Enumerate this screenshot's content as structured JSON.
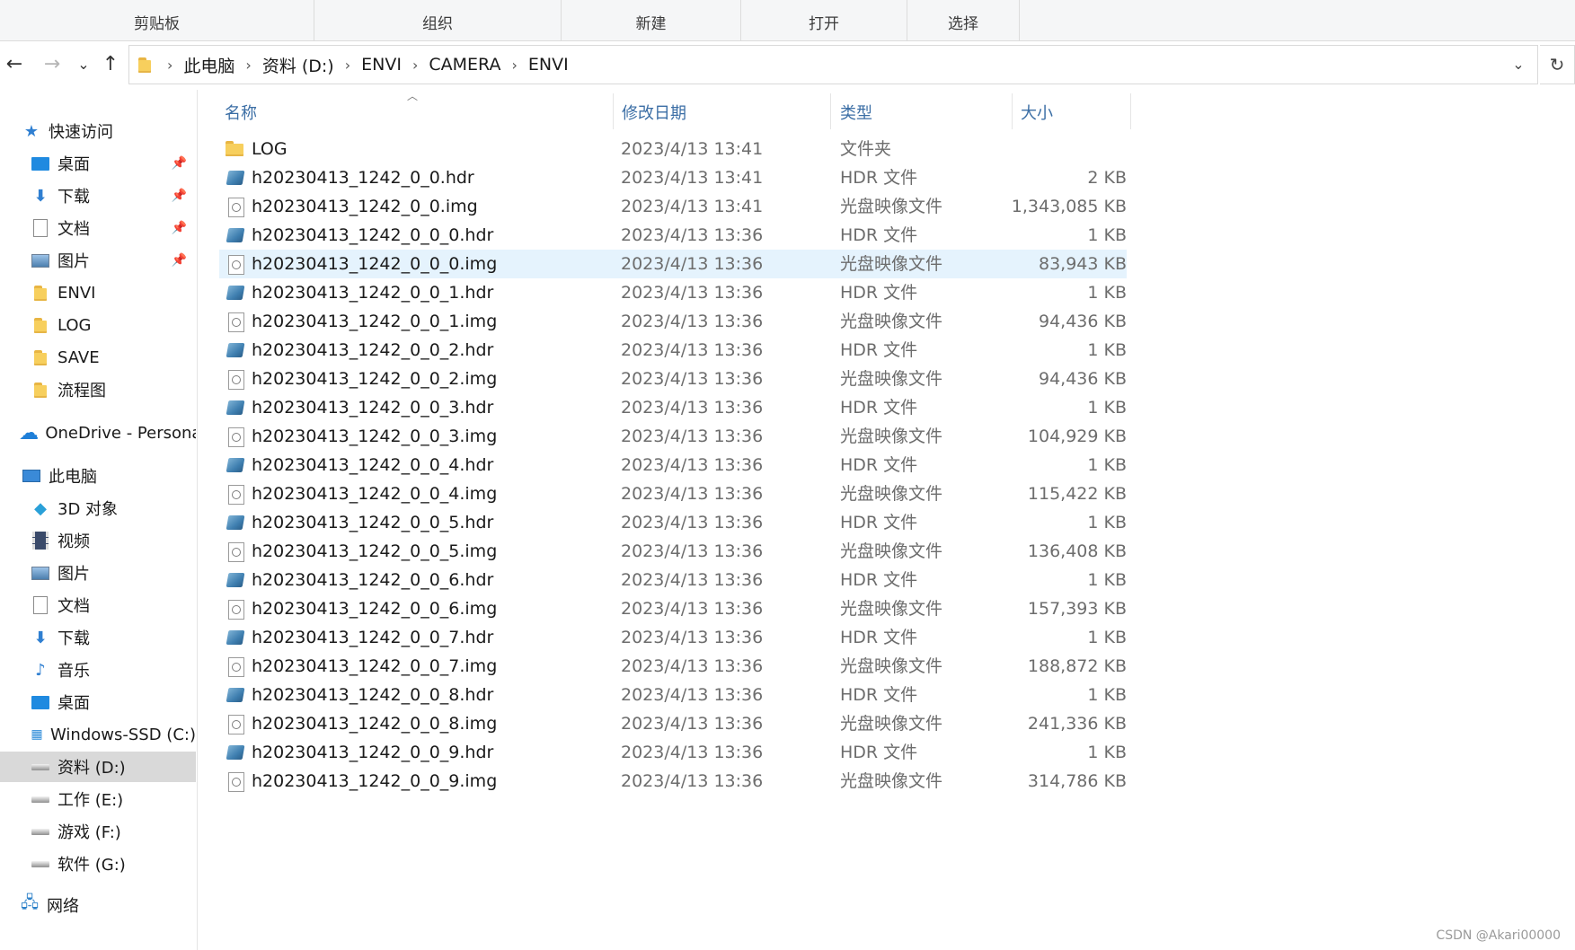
{
  "ribbon": {
    "groups": [
      "剪贴板",
      "组织",
      "新建",
      "打开",
      "选择"
    ]
  },
  "nav": {
    "back_icon": "←",
    "forward_icon": "→",
    "recent_icon": "⌄",
    "up_icon": "↑",
    "breadcrumb": [
      "此电脑",
      "资料 (D:)",
      "ENVI",
      "CAMERA",
      "ENVI"
    ],
    "separator": "›",
    "dropdown_icon": "⌄",
    "refresh_icon": "↻"
  },
  "sidebar": {
    "quick_access": "快速访问",
    "quick_items": [
      {
        "label": "桌面",
        "icon": "desktop-icon",
        "pinned": true
      },
      {
        "label": "下载",
        "icon": "download-icon",
        "pinned": true
      },
      {
        "label": "文档",
        "icon": "document-icon",
        "pinned": true
      },
      {
        "label": "图片",
        "icon": "picture-icon",
        "pinned": true
      },
      {
        "label": "ENVI",
        "icon": "folder-icon",
        "pinned": false
      },
      {
        "label": "LOG",
        "icon": "folder-icon",
        "pinned": false
      },
      {
        "label": "SAVE",
        "icon": "folder-icon",
        "pinned": false
      },
      {
        "label": "流程图",
        "icon": "folder-icon",
        "pinned": false
      }
    ],
    "onedrive": "OneDrive - Personal",
    "this_pc": "此电脑",
    "pc_items": [
      {
        "label": "3D 对象",
        "icon": "3d-objects-icon"
      },
      {
        "label": "视频",
        "icon": "video-icon"
      },
      {
        "label": "图片",
        "icon": "picture-icon"
      },
      {
        "label": "文档",
        "icon": "document-icon"
      },
      {
        "label": "下载",
        "icon": "download-icon"
      },
      {
        "label": "音乐",
        "icon": "music-icon"
      },
      {
        "label": "桌面",
        "icon": "desktop-icon"
      },
      {
        "label": "Windows-SSD (C:)",
        "icon": "windows-drive-icon"
      },
      {
        "label": "资料 (D:)",
        "icon": "drive-icon",
        "selected": true
      },
      {
        "label": "工作 (E:)",
        "icon": "drive-icon"
      },
      {
        "label": "游戏 (F:)",
        "icon": "drive-icon"
      },
      {
        "label": "软件 (G:)",
        "icon": "drive-icon"
      }
    ],
    "network": "网络"
  },
  "columns": {
    "name": "名称",
    "date": "修改日期",
    "type": "类型",
    "size": "大小"
  },
  "files": [
    {
      "name": "LOG",
      "date": "2023/4/13 13:41",
      "type": "文件夹",
      "size": "",
      "icon": "folder-icon"
    },
    {
      "name": "h20230413_1242_0_0.hdr",
      "date": "2023/4/13 13:41",
      "type": "HDR 文件",
      "size": "2 KB",
      "icon": "hdr-file-icon"
    },
    {
      "name": "h20230413_1242_0_0.img",
      "date": "2023/4/13 13:41",
      "type": "光盘映像文件",
      "size": "1,343,085 KB",
      "icon": "disc-image-icon"
    },
    {
      "name": "h20230413_1242_0_0_0.hdr",
      "date": "2023/4/13 13:36",
      "type": "HDR 文件",
      "size": "1 KB",
      "icon": "hdr-file-icon"
    },
    {
      "name": "h20230413_1242_0_0_0.img",
      "date": "2023/4/13 13:36",
      "type": "光盘映像文件",
      "size": "83,943 KB",
      "icon": "disc-image-icon",
      "selected": true
    },
    {
      "name": "h20230413_1242_0_0_1.hdr",
      "date": "2023/4/13 13:36",
      "type": "HDR 文件",
      "size": "1 KB",
      "icon": "hdr-file-icon"
    },
    {
      "name": "h20230413_1242_0_0_1.img",
      "date": "2023/4/13 13:36",
      "type": "光盘映像文件",
      "size": "94,436 KB",
      "icon": "disc-image-icon"
    },
    {
      "name": "h20230413_1242_0_0_2.hdr",
      "date": "2023/4/13 13:36",
      "type": "HDR 文件",
      "size": "1 KB",
      "icon": "hdr-file-icon"
    },
    {
      "name": "h20230413_1242_0_0_2.img",
      "date": "2023/4/13 13:36",
      "type": "光盘映像文件",
      "size": "94,436 KB",
      "icon": "disc-image-icon"
    },
    {
      "name": "h20230413_1242_0_0_3.hdr",
      "date": "2023/4/13 13:36",
      "type": "HDR 文件",
      "size": "1 KB",
      "icon": "hdr-file-icon"
    },
    {
      "name": "h20230413_1242_0_0_3.img",
      "date": "2023/4/13 13:36",
      "type": "光盘映像文件",
      "size": "104,929 KB",
      "icon": "disc-image-icon"
    },
    {
      "name": "h20230413_1242_0_0_4.hdr",
      "date": "2023/4/13 13:36",
      "type": "HDR 文件",
      "size": "1 KB",
      "icon": "hdr-file-icon"
    },
    {
      "name": "h20230413_1242_0_0_4.img",
      "date": "2023/4/13 13:36",
      "type": "光盘映像文件",
      "size": "115,422 KB",
      "icon": "disc-image-icon"
    },
    {
      "name": "h20230413_1242_0_0_5.hdr",
      "date": "2023/4/13 13:36",
      "type": "HDR 文件",
      "size": "1 KB",
      "icon": "hdr-file-icon"
    },
    {
      "name": "h20230413_1242_0_0_5.img",
      "date": "2023/4/13 13:36",
      "type": "光盘映像文件",
      "size": "136,408 KB",
      "icon": "disc-image-icon"
    },
    {
      "name": "h20230413_1242_0_0_6.hdr",
      "date": "2023/4/13 13:36",
      "type": "HDR 文件",
      "size": "1 KB",
      "icon": "hdr-file-icon"
    },
    {
      "name": "h20230413_1242_0_0_6.img",
      "date": "2023/4/13 13:36",
      "type": "光盘映像文件",
      "size": "157,393 KB",
      "icon": "disc-image-icon"
    },
    {
      "name": "h20230413_1242_0_0_7.hdr",
      "date": "2023/4/13 13:36",
      "type": "HDR 文件",
      "size": "1 KB",
      "icon": "hdr-file-icon"
    },
    {
      "name": "h20230413_1242_0_0_7.img",
      "date": "2023/4/13 13:36",
      "type": "光盘映像文件",
      "size": "188,872 KB",
      "icon": "disc-image-icon"
    },
    {
      "name": "h20230413_1242_0_0_8.hdr",
      "date": "2023/4/13 13:36",
      "type": "HDR 文件",
      "size": "1 KB",
      "icon": "hdr-file-icon"
    },
    {
      "name": "h20230413_1242_0_0_8.img",
      "date": "2023/4/13 13:36",
      "type": "光盘映像文件",
      "size": "241,336 KB",
      "icon": "disc-image-icon"
    },
    {
      "name": "h20230413_1242_0_0_9.hdr",
      "date": "2023/4/13 13:36",
      "type": "HDR 文件",
      "size": "1 KB",
      "icon": "hdr-file-icon"
    },
    {
      "name": "h20230413_1242_0_0_9.img",
      "date": "2023/4/13 13:36",
      "type": "光盘映像文件",
      "size": "314,786 KB",
      "icon": "disc-image-icon"
    }
  ],
  "watermark": "CSDN @Akari00000",
  "colors": {
    "selected_row": "#e5f3fd",
    "selected_sidebar": "#d9d9d9",
    "header_text": "#3b6ea5",
    "folder": "#f7cf5d"
  }
}
